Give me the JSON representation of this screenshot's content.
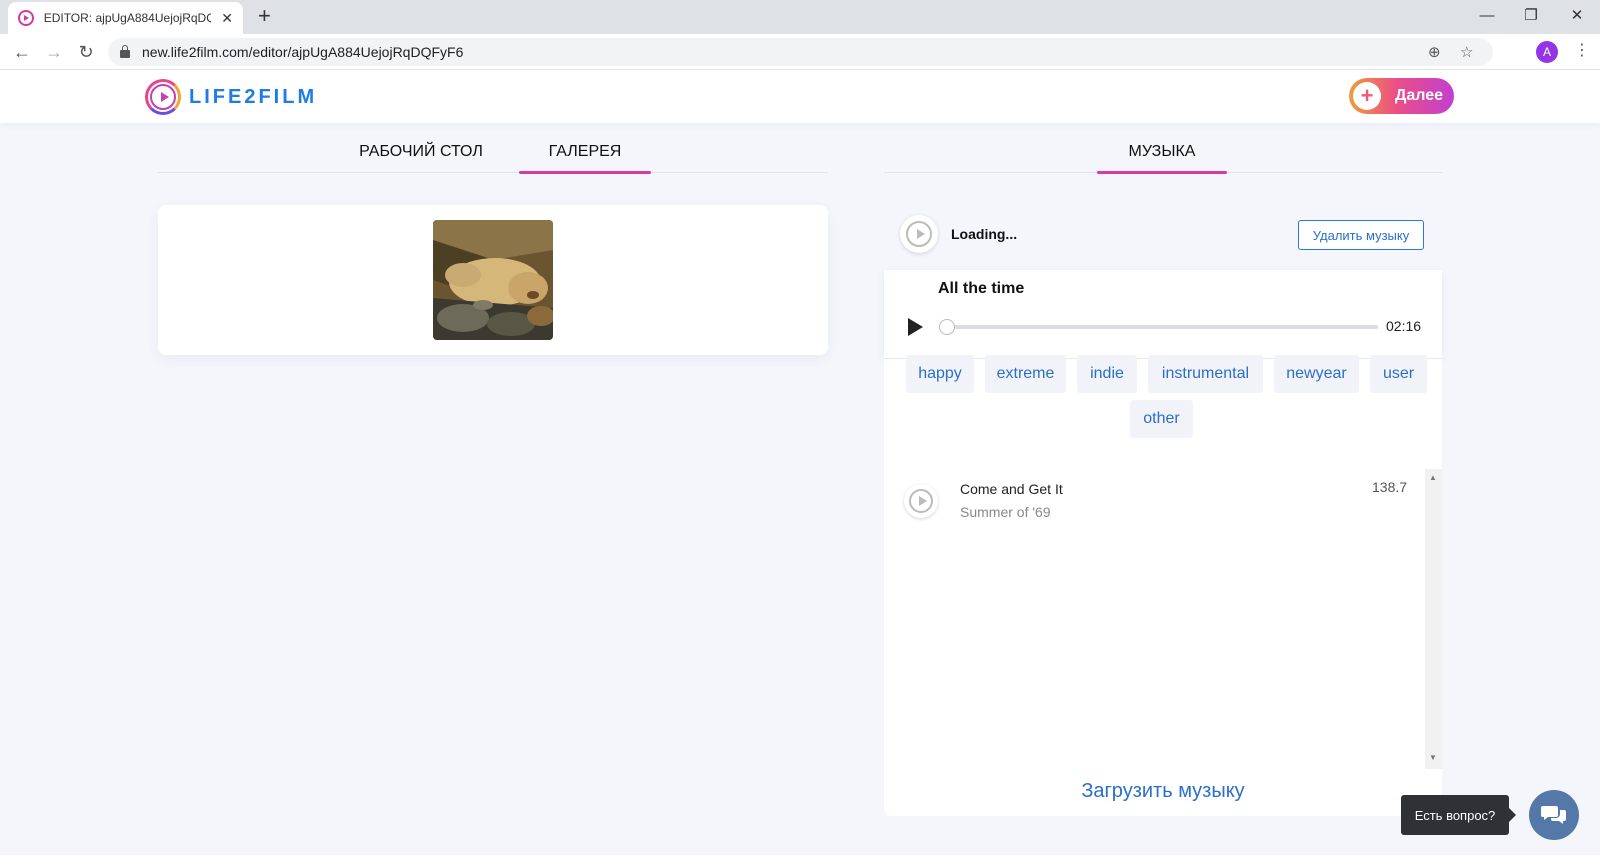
{
  "browser": {
    "tab_title": "EDITOR: ajpUgA884UejojRqDQFyF6",
    "url": "new.life2film.com/editor/ajpUgA884UejojRqDQFyF6",
    "profile_initial": "A"
  },
  "header": {
    "logo_text": "LIFE2FILM",
    "next_label": "Далее"
  },
  "left_panel": {
    "tabs": [
      {
        "label": "РАБОЧИЙ СТОЛ",
        "active": false
      },
      {
        "label": "ГАЛЕРЕЯ",
        "active": true
      }
    ]
  },
  "right_panel": {
    "tab": "МУЗЫКА",
    "loading_text": "Loading...",
    "delete_music_label": "Удалить музыку",
    "player": {
      "title": "All the time",
      "duration": "02:16",
      "progress": 0
    },
    "genres": [
      "happy",
      "extreme",
      "indie",
      "instrumental",
      "newyear",
      "user",
      "other"
    ],
    "tracks": [
      {
        "title": "Come and Get It",
        "artist": "Summer of '69",
        "value": "138.7"
      }
    ],
    "upload_label": "Загрузить музыку"
  },
  "chat": {
    "tooltip": "Есть вопрос?"
  },
  "colors": {
    "accent_blue": "#2a6fc9",
    "tab_underline": "#d63aa9",
    "page_bg": "#f4f6fc"
  }
}
